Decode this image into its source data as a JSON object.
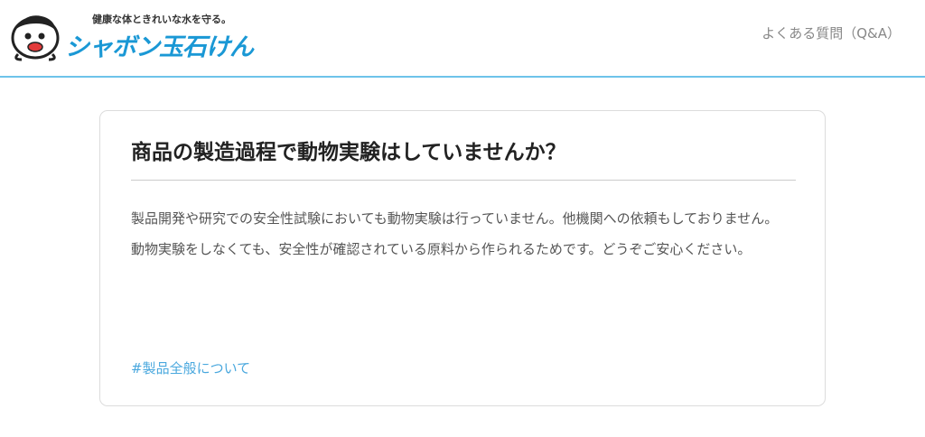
{
  "header": {
    "tagline": "健康な体ときれいな水を守る。",
    "brand_name": "シャボン玉石けん",
    "nav_link": "よくある質問（Q&A）",
    "accent_color": "#1a98d5",
    "border_color": "#6ec3ea",
    "mascot_icon": "soap-bubble-mascot-icon"
  },
  "faq": {
    "question": "商品の製造過程で動物実験はしていませんか？",
    "answer": "製品開発や研究での安全性試験においても動物実験は行っていません。他機関への依頼もしておりません。動物実験をしなくても、安全性が確認されている原料から作られるためです。どうぞご安心ください。",
    "tag": "#製品全般について",
    "tag_color": "#4aa8de"
  }
}
